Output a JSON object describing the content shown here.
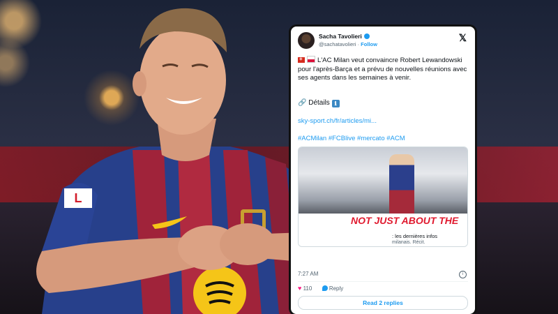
{
  "tweet": {
    "author_name": "Sacha Tavolieri",
    "author_handle": "@sachatavolieri",
    "follow_label": "Follow",
    "x_logo": "𝕏",
    "text": "L'AC Milan veut convaincre Robert Lewandowski pour l'après-Barça et a prévu de nouvelles réunions avec ses agents dans les semaines à venir.",
    "details_label": "Détails",
    "details_icon": "ℹ",
    "link": "sky-sport.ch/fr/articles/mi...",
    "hashtags": "#ACMilan #FCBlive #mercato #ACM",
    "media": {
      "banner_text": "NOT JUST ABOUT THE",
      "title": ": les dernières infos",
      "subtitle": "milanais. Récit."
    },
    "timestamp": "7:27 AM",
    "likes": "110",
    "reply_label": "Reply",
    "read_replies_label": "Read 2 replies"
  },
  "colors": {
    "accent": "#1d9bf0",
    "like": "#f91880"
  }
}
